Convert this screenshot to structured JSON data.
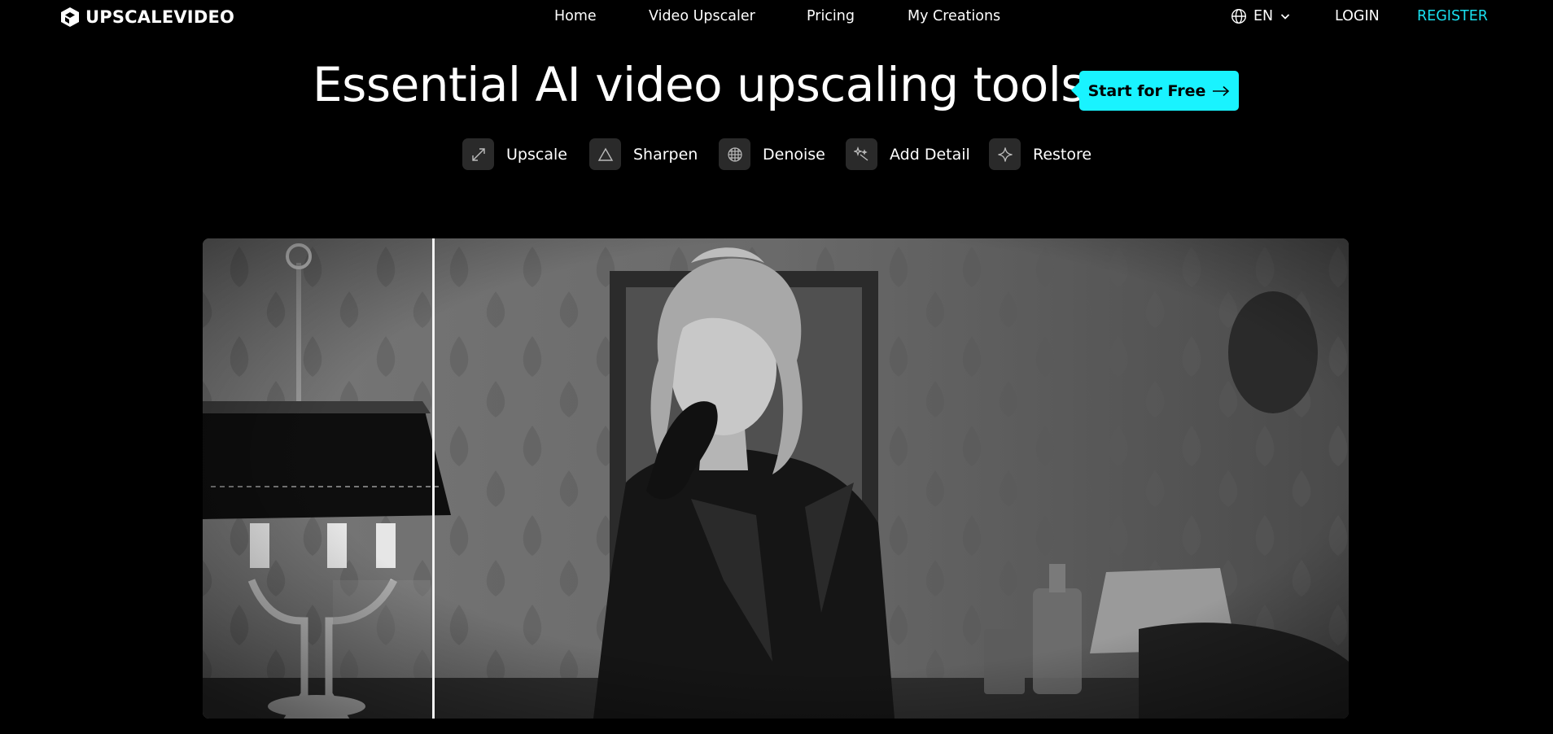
{
  "brand": {
    "name": "UPSCALEVIDEO",
    "logo_icon": "cube-logo-icon"
  },
  "nav": {
    "items": [
      {
        "label": "Home"
      },
      {
        "label": "Video Upscaler"
      },
      {
        "label": "Pricing"
      },
      {
        "label": "My Creations"
      }
    ],
    "language": {
      "label": "EN",
      "icon": "globe-icon",
      "chevron": "chevron-down-icon"
    },
    "login": "LOGIN",
    "register": "REGISTER"
  },
  "hero": {
    "title": "Essential AI video upscaling tools.",
    "cta": "Start for Free"
  },
  "tools": [
    {
      "label": "Upscale",
      "icon": "expand-diagonal-icon"
    },
    {
      "label": "Sharpen",
      "icon": "triangle-icon"
    },
    {
      "label": "Denoise",
      "icon": "grid-circle-icon"
    },
    {
      "label": "Add Detail",
      "icon": "sparkle-wand-icon"
    },
    {
      "label": "Restore",
      "icon": "four-point-star-icon"
    }
  ],
  "colors": {
    "accent": "#19f3ff",
    "register": "#19e0f0",
    "background": "#000000",
    "tool_icon_bg": "#2a2a2a"
  }
}
